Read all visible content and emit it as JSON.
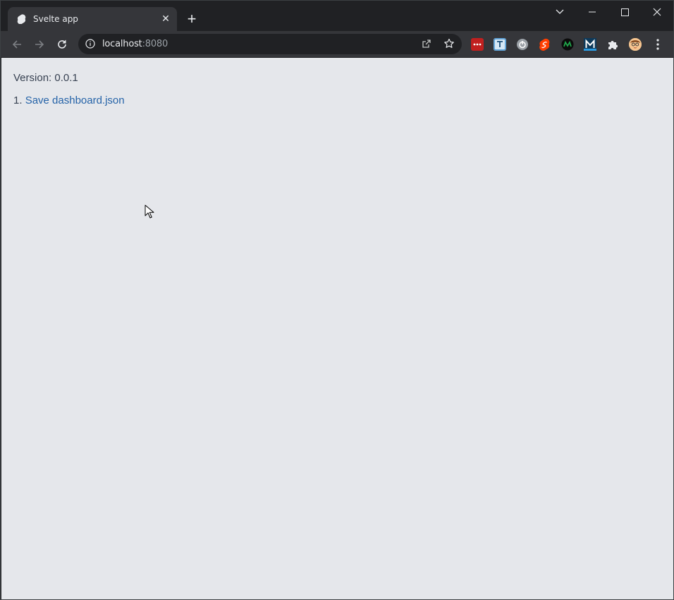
{
  "browser": {
    "tab": {
      "title": "Svelte app",
      "favicon": "svelte-logo-icon"
    },
    "address": {
      "host": "localhost",
      "port": ":8080"
    },
    "extensions": [
      "lastpass-icon",
      "translate-icon",
      "timer-icon",
      "svelte-devtools-icon",
      "mantis-icon",
      "m-icon",
      "puzzle-icon",
      "profile-avatar"
    ]
  },
  "page": {
    "version_label": "Version: 0.0.1",
    "list": [
      {
        "number": "1.",
        "link_text": "Save dashboard.json"
      }
    ]
  },
  "colors": {
    "page_background": "#e5e7eb",
    "link": "#2563a8",
    "chrome_dark": "#202124",
    "chrome_toolbar": "#35363a"
  }
}
